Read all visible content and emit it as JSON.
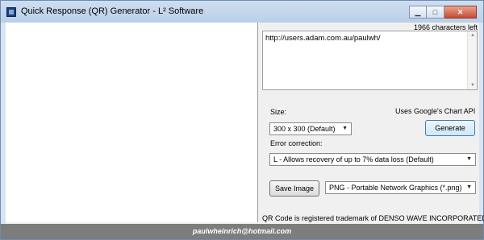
{
  "window": {
    "title": "Quick Response (QR) Generator - L² Software",
    "controls": {
      "minimize_icon": "minimize-icon",
      "maximize_icon": "maximize-icon",
      "close_icon": "close-icon"
    }
  },
  "input": {
    "chars_left": "1966 characters left",
    "text": "http://users.adam.com.au/paulwh/"
  },
  "options": {
    "size_label": "Size:",
    "api_note": "Uses Google's Chart API",
    "size_value": "300 x 300 (Default)",
    "generate_label": "Generate",
    "error_label": "Error correction:",
    "error_value": "L  - Allows recovery of up to 7% data loss (Default)",
    "save_label": "Save Image",
    "format_value": "PNG - Portable Network Graphics (*.png)"
  },
  "footer": {
    "trademark": "QR Code is registered trademark of DENSO WAVE INCORPORATED",
    "email": "paulwheinrich@hotmail.com"
  },
  "colors": {
    "titlebar": "#c4d7ec",
    "statusbar": "#7d7d7d",
    "close": "#c84c31"
  }
}
